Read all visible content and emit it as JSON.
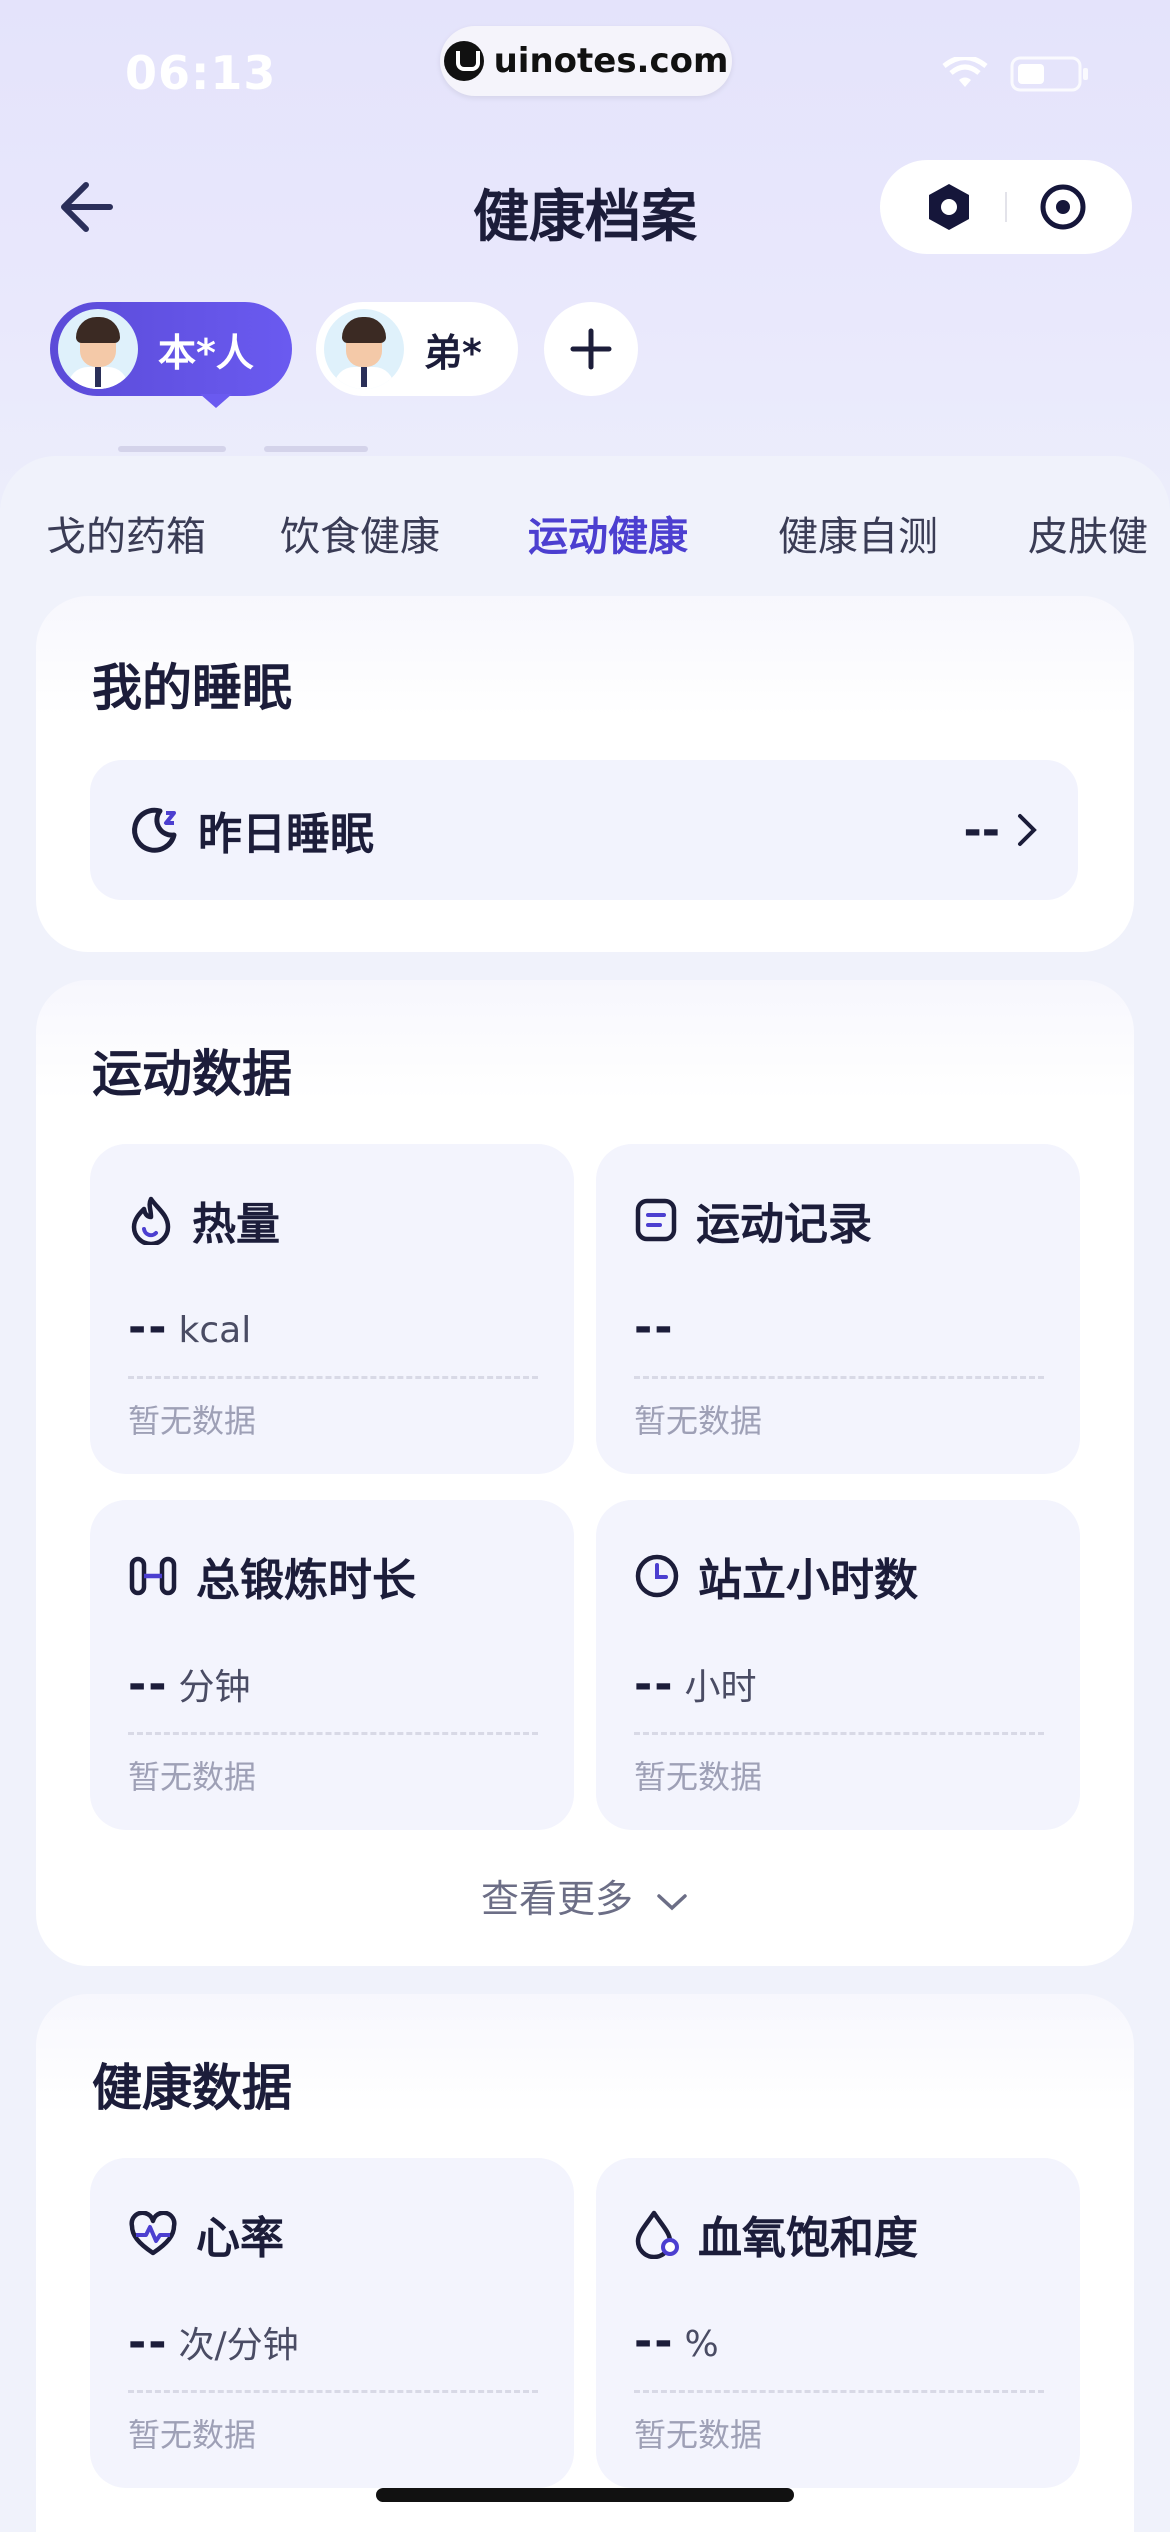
{
  "status": {
    "time": "06:13"
  },
  "watermark": {
    "text": "uinotes.com"
  },
  "nav": {
    "title": "健康档案"
  },
  "profiles": [
    {
      "name": "本*人",
      "active": true
    },
    {
      "name": "弟*",
      "active": false
    }
  ],
  "tabs": [
    "我的药箱",
    "饮食健康",
    "运动健康",
    "健康自测",
    "皮肤健康"
  ],
  "tabs_visible": [
    "戈的药箱",
    "饮食健康",
    "运动健康",
    "健康自测",
    "皮肤健"
  ],
  "active_tab": "运动健康",
  "sleep_card": {
    "title": "我的睡眠",
    "row_label": "昨日睡眠",
    "row_value": "--"
  },
  "sport_card": {
    "title": "运动数据",
    "tiles": [
      {
        "icon": "flame-icon",
        "label": "热量",
        "value": "--",
        "unit": "kcal",
        "empty": "暂无数据"
      },
      {
        "icon": "record-icon",
        "label": "运动记录",
        "value": "--",
        "unit": "",
        "empty": "暂无数据"
      },
      {
        "icon": "dumbbell-icon",
        "label": "总锻炼时长",
        "value": "--",
        "unit": "分钟",
        "empty": "暂无数据"
      },
      {
        "icon": "clock-icon",
        "label": "站立小时数",
        "value": "--",
        "unit": "小时",
        "empty": "暂无数据"
      }
    ],
    "more": "查看更多"
  },
  "health_card": {
    "title": "健康数据",
    "tiles": [
      {
        "icon": "heart-rate-icon",
        "label": "心率",
        "value": "--",
        "unit": "次/分钟",
        "empty": "暂无数据"
      },
      {
        "icon": "blood-oxygen-icon",
        "label": "血氧饱和度",
        "value": "--",
        "unit": "%",
        "empty": "暂无数据"
      }
    ]
  },
  "colors": {
    "accent": "#4c3fd0",
    "profile_active": "#5b4bd8",
    "background": "#eef0fb"
  }
}
